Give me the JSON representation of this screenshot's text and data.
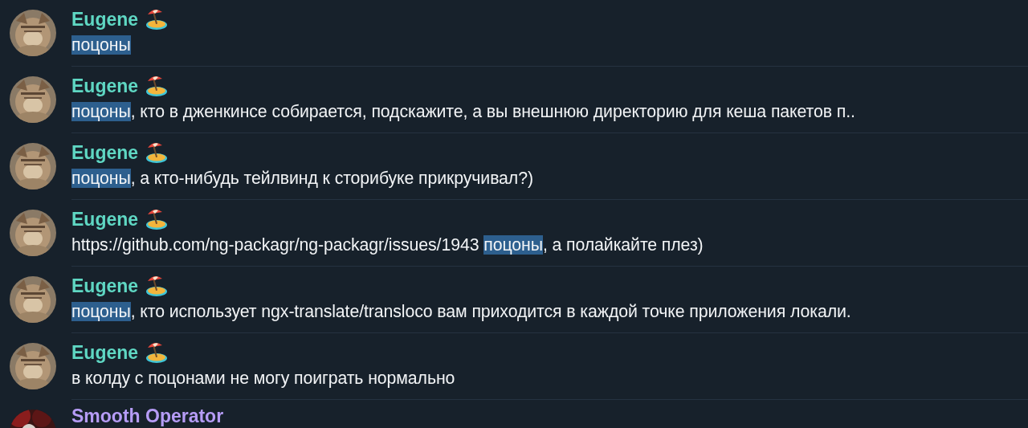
{
  "messages": [
    {
      "author": "Eugene",
      "color": "#5fd7c3",
      "emoji": true,
      "parts": [
        {
          "text": "поцоны",
          "highlighted": true
        }
      ]
    },
    {
      "author": "Eugene",
      "color": "#5fd7c3",
      "emoji": true,
      "parts": [
        {
          "text": "поцоны",
          "highlighted": true
        },
        {
          "text": ", кто в дженкинсе собирается, подскажите, а вы внешнюю директорию для кеша пакетов п..",
          "highlighted": false
        }
      ]
    },
    {
      "author": "Eugene",
      "color": "#5fd7c3",
      "emoji": true,
      "parts": [
        {
          "text": "поцоны",
          "highlighted": true
        },
        {
          "text": ", а кто-нибудь тейлвинд к сторибуке прикручивал?)",
          "highlighted": false
        }
      ]
    },
    {
      "author": "Eugene",
      "color": "#5fd7c3",
      "emoji": true,
      "parts": [
        {
          "text": "https://github.com/ng-packagr/ng-packagr/issues/1943 ",
          "highlighted": false
        },
        {
          "text": "поцоны",
          "highlighted": true
        },
        {
          "text": ", а полайкайте плез)",
          "highlighted": false
        }
      ]
    },
    {
      "author": "Eugene",
      "color": "#5fd7c3",
      "emoji": true,
      "parts": [
        {
          "text": "поцоны",
          "highlighted": true
        },
        {
          "text": ", кто использует ngx-translate/transloco вам приходится в каждой точке приложения локали.",
          "highlighted": false
        }
      ]
    },
    {
      "author": "Eugene",
      "color": "#5fd7c3",
      "emoji": true,
      "parts": [
        {
          "text": "в колду с поцонами не могу поиграть нормально",
          "highlighted": false
        }
      ]
    },
    {
      "author": "Smooth Operator",
      "color": "#b69cf6",
      "emoji": false
    }
  ]
}
